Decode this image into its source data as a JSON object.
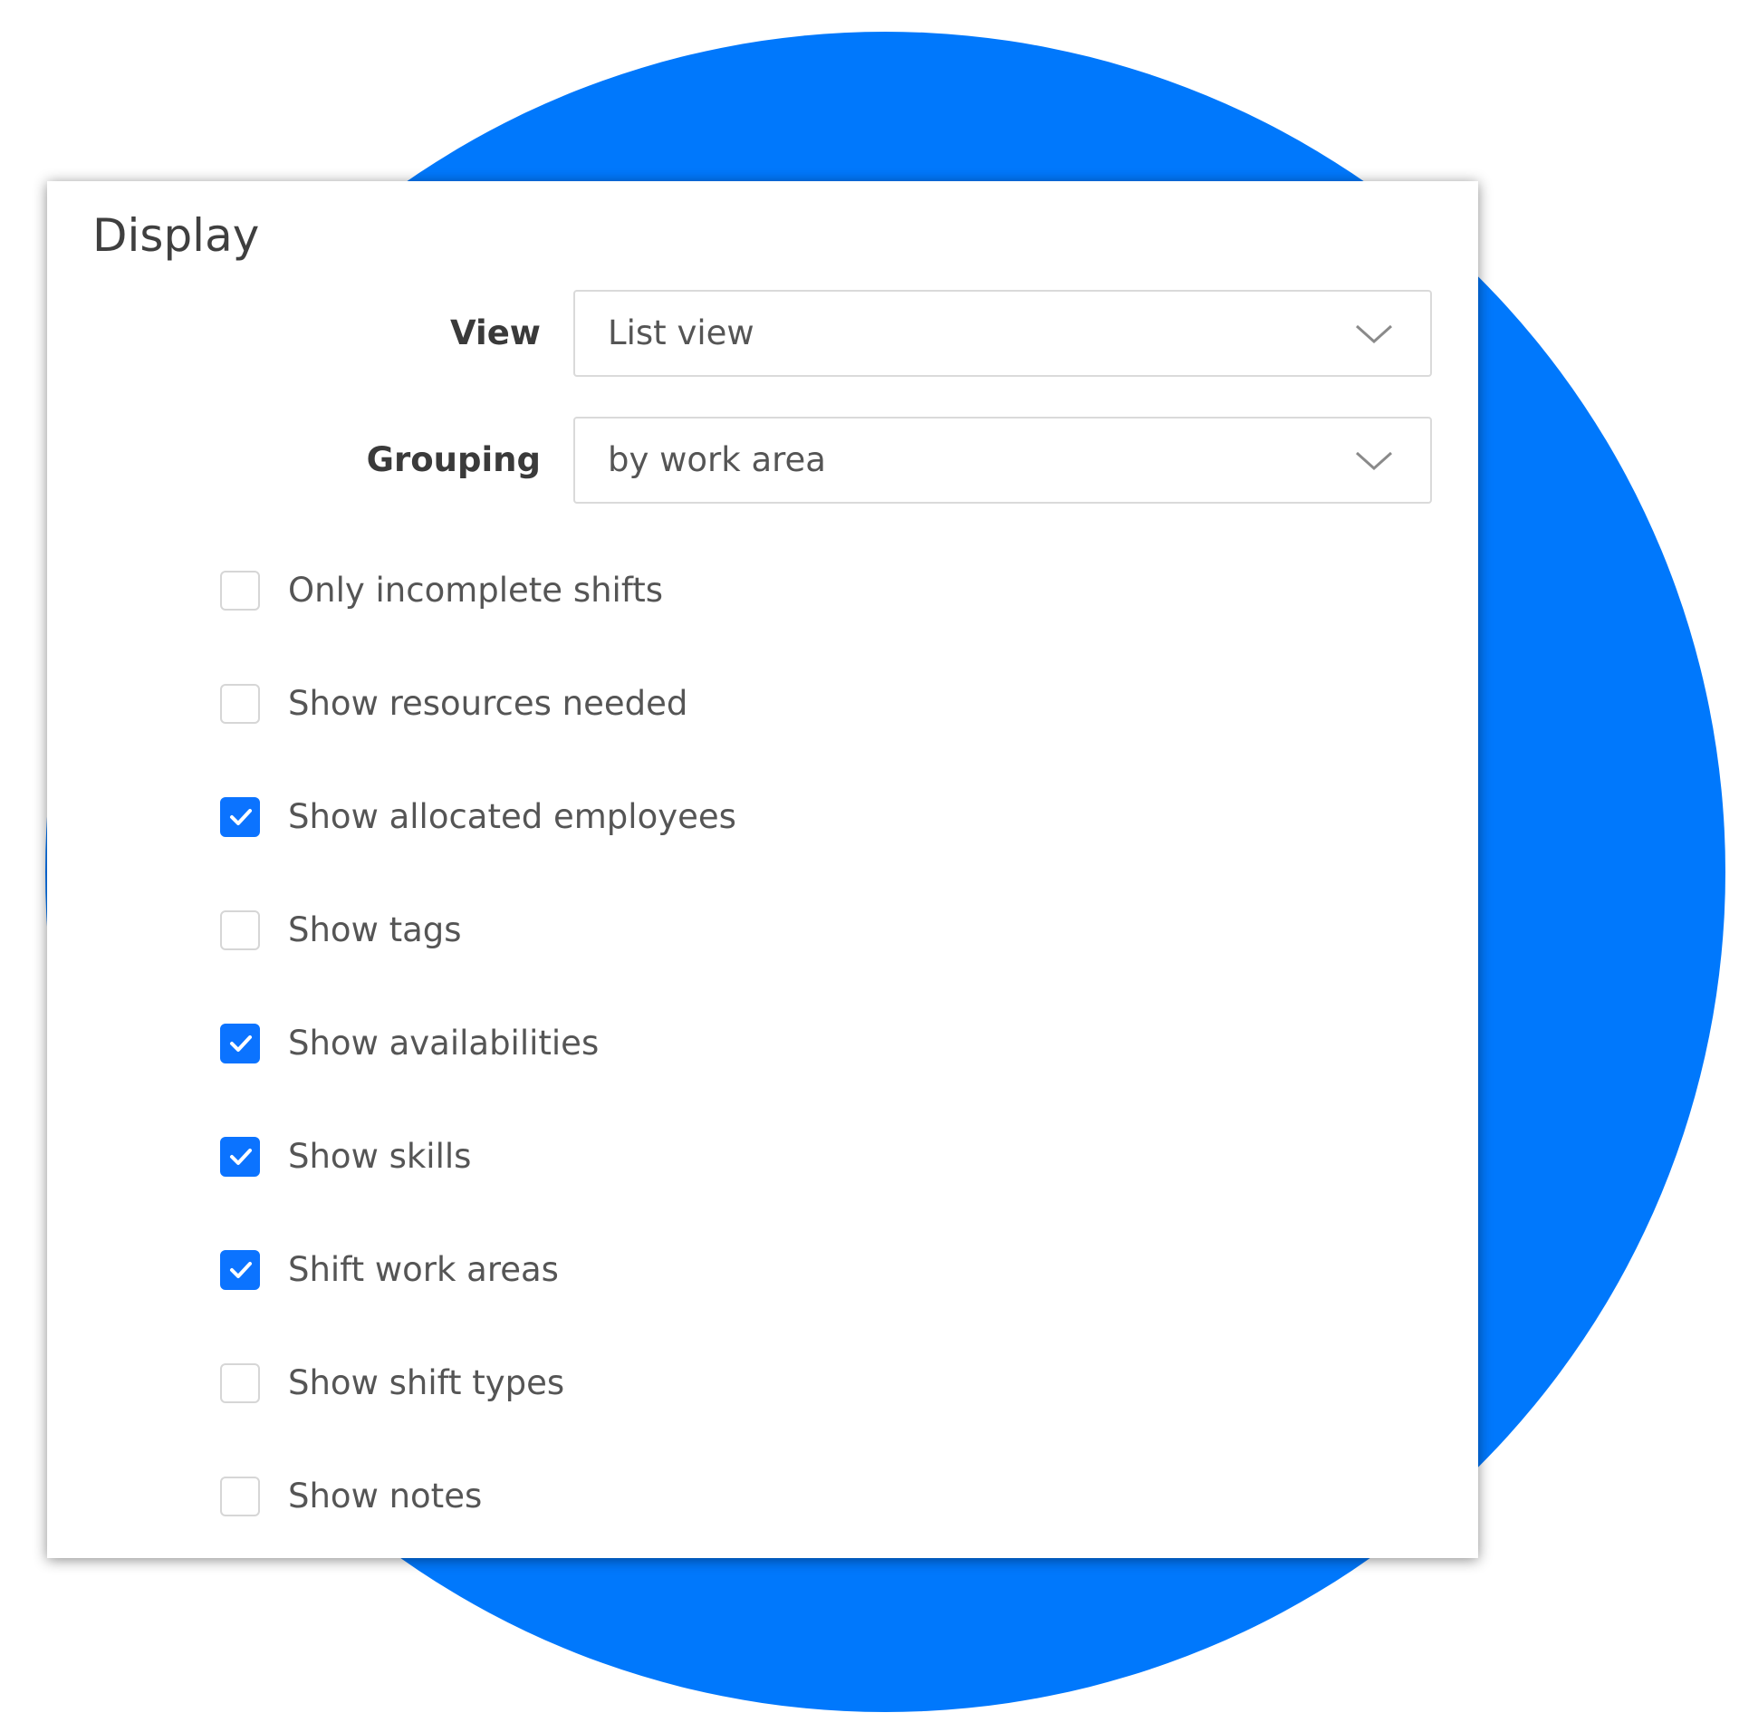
{
  "colors": {
    "accent": "#0078fc",
    "checkbox_checked": "#0b73ff"
  },
  "panel": {
    "title": "Display",
    "view": {
      "label": "View",
      "value": "List view",
      "icon": "chevron-down-icon"
    },
    "grouping": {
      "label": "Grouping",
      "value": "by work area",
      "icon": "chevron-down-icon"
    },
    "options": [
      {
        "label": "Only incomplete shifts",
        "checked": false
      },
      {
        "label": "Show resources needed",
        "checked": false
      },
      {
        "label": "Show allocated employees",
        "checked": true
      },
      {
        "label": "Show tags",
        "checked": false
      },
      {
        "label": "Show availabilities",
        "checked": true
      },
      {
        "label": "Show skills",
        "checked": true
      },
      {
        "label": "Shift work areas",
        "checked": true
      },
      {
        "label": "Show shift types",
        "checked": false
      },
      {
        "label": "Show notes",
        "checked": false
      }
    ]
  }
}
